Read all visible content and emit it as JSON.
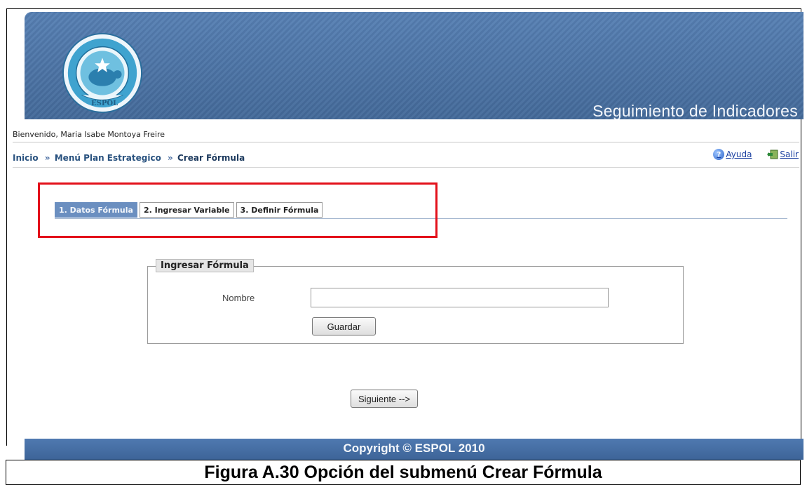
{
  "banner": {
    "title": "Seguimiento de Indicadores",
    "logo_text": "ESPOL",
    "logo_ring_text": "ESCUELA SUPERIOR POLITÉCNICA DEL LITORAL"
  },
  "welcome": "Bienvenido, Maria Isabe Montoya Freire",
  "breadcrumb": {
    "items": [
      "Inicio",
      "Menú Plan Estrategico",
      "Crear Fórmula"
    ],
    "separator": "»"
  },
  "links": {
    "help": "Ayuda",
    "exit": "Salir"
  },
  "tabs": [
    {
      "label": "1. Datos Fórmula",
      "active": true
    },
    {
      "label": "2. Ingresar Variable",
      "active": false
    },
    {
      "label": "3. Definir Fórmula",
      "active": false
    }
  ],
  "form": {
    "legend": "Ingresar Fórmula",
    "name_label": "Nombre",
    "name_value": "",
    "save_button": "Guardar"
  },
  "next_button": "Siguiente -->",
  "footer": "Copyright © ESPOL 2010",
  "caption": "Figura A.30 Opción del submenú Crear Fórmula",
  "colors": {
    "banner": "#4a73a7",
    "highlight": "#e3101a",
    "tab_active": "#6b8fc0",
    "link": "#1a3fa0"
  }
}
